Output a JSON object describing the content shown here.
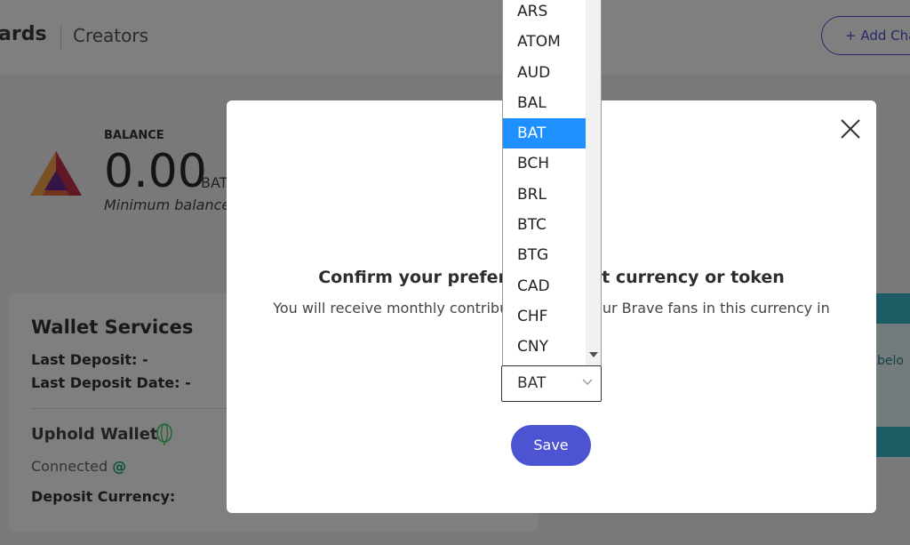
{
  "header": {
    "brand_fragment": "ards",
    "nav_creators": "Creators",
    "add_channel_label": "+ Add Channel"
  },
  "balance": {
    "label": "BALANCE",
    "amount": "0.00",
    "unit": "BAT",
    "minimum_note": "Minimum balance"
  },
  "wallet": {
    "title": "Wallet Services",
    "last_deposit": "Last Deposit: -",
    "last_deposit_date": "Last Deposit Date: -",
    "uphold_title": "Uphold Wallet",
    "connected": "Connected",
    "connected_symbol": "@",
    "deposit_currency": "Deposit Currency:"
  },
  "right_card": {
    "text_fragment": "el belo"
  },
  "modal": {
    "title": "Confirm your preferred payout currency or token",
    "description": "You will receive monthly contributions from your Brave fans in this currency in",
    "selected_currency": "BAT",
    "save_label": "Save"
  },
  "dropdown": {
    "options": [
      "ARS",
      "ATOM",
      "AUD",
      "BAL",
      "BAT",
      "BCH",
      "BRL",
      "BTC",
      "BTG",
      "CAD",
      "CHF",
      "CNY"
    ],
    "highlighted": "BAT"
  },
  "colors": {
    "accent": "#4c54d2",
    "highlight": "#1e90ff",
    "bat_orange": "#e8623d",
    "uphold_green": "#49cc68"
  }
}
